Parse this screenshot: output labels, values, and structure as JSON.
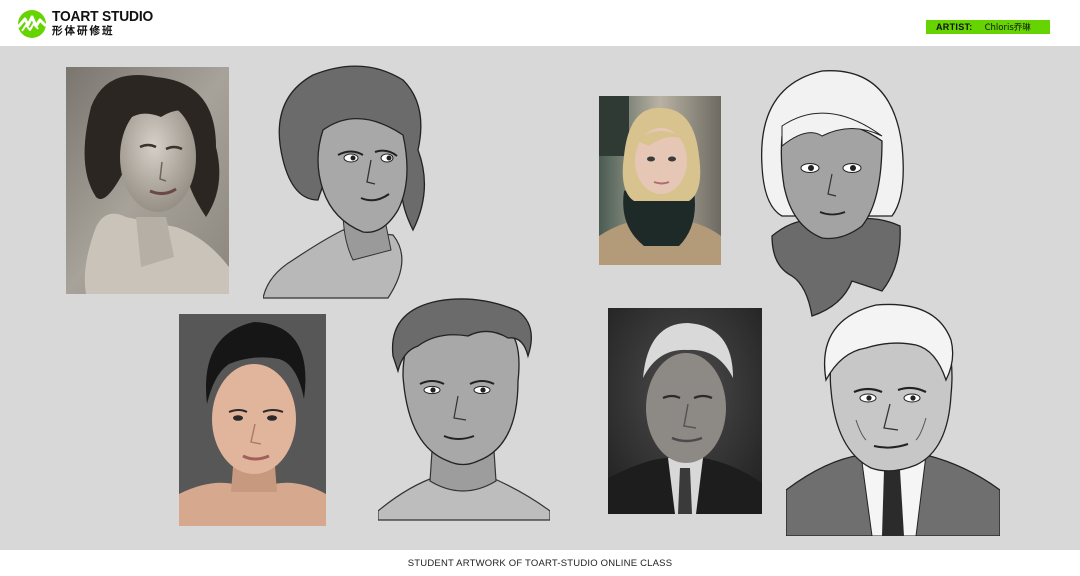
{
  "header": {
    "brand_title": "TOART STUDIO",
    "brand_subtitle": "形体研修班",
    "logo_icon": "toart-logo-icon",
    "accent_color": "#66d400"
  },
  "artist": {
    "label": "ARTIST:",
    "name": "Chloris乔琳"
  },
  "gallery": {
    "background": "#d8d8d8",
    "items": [
      {
        "kind": "photo",
        "subject": "woman-curly-hair-bw"
      },
      {
        "kind": "drawing",
        "subject": "woman-curly-hair-sketch"
      },
      {
        "kind": "photo",
        "subject": "blonde-girl-scarf"
      },
      {
        "kind": "drawing",
        "subject": "blonde-girl-scarf-sketch"
      },
      {
        "kind": "photo",
        "subject": "young-man-portrait"
      },
      {
        "kind": "drawing",
        "subject": "young-man-sketch"
      },
      {
        "kind": "photo",
        "subject": "old-man-suit"
      },
      {
        "kind": "drawing",
        "subject": "old-man-suit-sketch"
      }
    ]
  },
  "footer": {
    "caption": "STUDENT ARTWORK OF TOART-STUDIO ONLINE CLASS"
  }
}
